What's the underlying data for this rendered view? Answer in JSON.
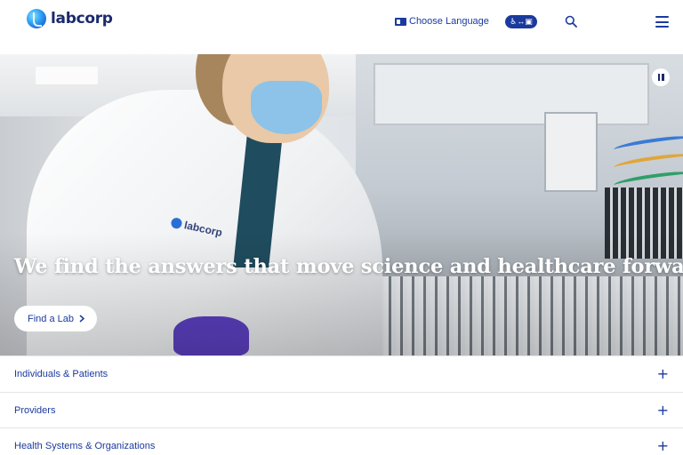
{
  "header": {
    "logo_text": "labcorp",
    "language_label": "Choose Language",
    "accessibility_label": "♿↔▣"
  },
  "hero": {
    "headline": "We find the answers that move science and healthcare forward",
    "cta_label": "Find a Lab",
    "badge_text": "labcorp"
  },
  "accordion": [
    {
      "label": "Individuals & Patients",
      "icon": "+"
    },
    {
      "label": "Providers",
      "icon": "+"
    },
    {
      "label": "Health Systems & Organizations",
      "icon": "+"
    }
  ],
  "colors": {
    "brand_blue": "#1b3a9e",
    "brand_navy": "#1b2a6e"
  }
}
